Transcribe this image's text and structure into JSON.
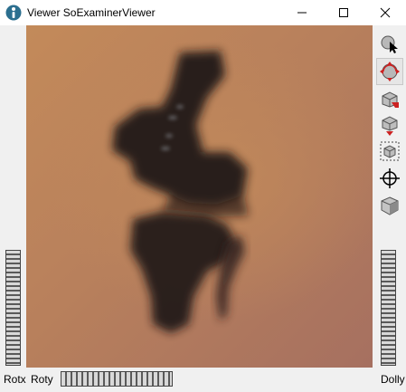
{
  "window": {
    "title": "Viewer SoExaminerViewer",
    "controls": [
      "minimize-icon",
      "maximize-icon",
      "close-icon"
    ]
  },
  "viewport": {
    "content": "volume-rendered-knee-joint",
    "background_color": "#b98359",
    "object_color": "#1a1211"
  },
  "toolbar": {
    "buttons": [
      {
        "name": "pick-mode",
        "icon": "pick-arrow-icon",
        "active": false
      },
      {
        "name": "view-mode",
        "icon": "rotate-arrows-icon",
        "active": true
      },
      {
        "name": "home",
        "icon": "home-view-icon",
        "active": false
      },
      {
        "name": "set-home",
        "icon": "set-home-icon",
        "active": false
      },
      {
        "name": "view-all",
        "icon": "view-all-icon",
        "active": false
      },
      {
        "name": "seek",
        "icon": "seek-crosshair-icon",
        "active": false
      },
      {
        "name": "toggle-camera",
        "icon": "perspective-cube-icon",
        "active": false
      }
    ]
  },
  "wheels": {
    "rotx_label": "Rotx",
    "roty_label": "Roty",
    "dolly_label": "Dolly"
  },
  "colors": {
    "accent_red": "#cc2222",
    "chrome": "#f0f0f0"
  }
}
